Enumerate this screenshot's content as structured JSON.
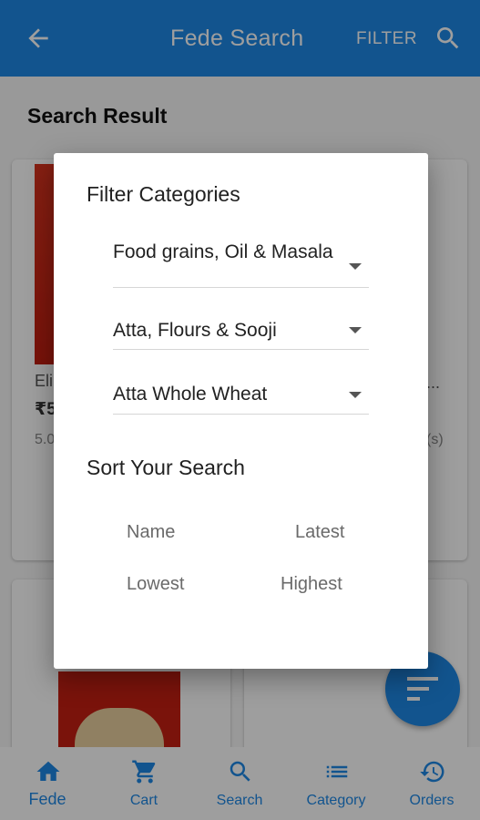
{
  "appbar": {
    "title": "Fede Search",
    "filter_label": "FILTER",
    "back_icon": "arrow-back-icon",
    "search_icon": "search-icon"
  },
  "content": {
    "section_title": "Search Result",
    "products": [
      {
        "name": "Eli",
        "price": "₹5",
        "rating": "5.0"
      },
      {
        "name": "...",
        "rating": "(s)"
      }
    ]
  },
  "dialog": {
    "title": "Filter Categories",
    "dropdowns": [
      {
        "value": "Food grains, Oil & Masala"
      },
      {
        "value": "Atta, Flours & Sooji"
      },
      {
        "value": "Atta Whole Wheat"
      }
    ],
    "sort_title": "Sort Your Search",
    "sort_options": {
      "name": "Name",
      "latest": "Latest",
      "lowest": "Lowest",
      "highest": "Highest"
    }
  },
  "bottom_nav": {
    "items": [
      {
        "label": "Fede",
        "icon": "home-icon"
      },
      {
        "label": "Cart",
        "icon": "cart-icon"
      },
      {
        "label": "Search",
        "icon": "search-icon"
      },
      {
        "label": "Category",
        "icon": "list-icon"
      },
      {
        "label": "Orders",
        "icon": "history-icon"
      }
    ]
  },
  "fab": {
    "icon": "sort-icon"
  },
  "colors": {
    "primary": "#1e88e5",
    "scrim": "rgba(0,0,0,0.38)",
    "dialog_bg": "#ffffff"
  }
}
